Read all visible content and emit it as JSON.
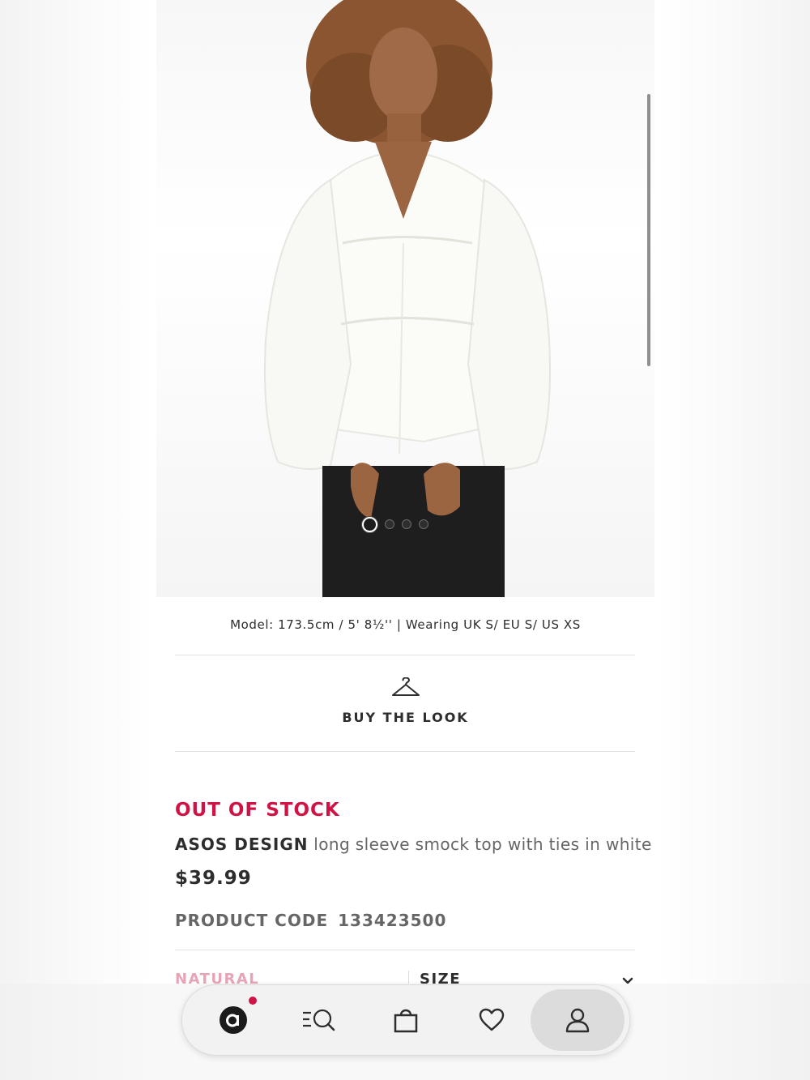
{
  "product_image": {
    "alt": "",
    "carousel": {
      "total": 4,
      "active_index": 0
    }
  },
  "model_info": "Model: 173.5cm / 5' 8½'' | Wearing UK S/ EU S/ US XS",
  "buy_the_look": {
    "label": "BUY THE LOOK",
    "icon": "hanger-icon"
  },
  "stock_status": "OUT OF STOCK",
  "product": {
    "brand": "ASOS DESIGN",
    "name": "long sleeve smock top with ties in white",
    "price": "$39.99",
    "code_label": "PRODUCT CODE",
    "code": "133423500"
  },
  "options": {
    "colour_value": "NATURAL",
    "size_label": "SIZE"
  },
  "colors": {
    "accent": "#d01345",
    "text": "#2d2d2d",
    "muted": "#666666"
  },
  "bottom_nav": [
    {
      "name": "home",
      "icon": "asos-logo-icon",
      "has_badge": true
    },
    {
      "name": "search",
      "icon": "search-icon"
    },
    {
      "name": "bag",
      "icon": "bag-icon"
    },
    {
      "name": "saved",
      "icon": "heart-icon"
    },
    {
      "name": "account",
      "icon": "user-icon",
      "active": true
    }
  ]
}
